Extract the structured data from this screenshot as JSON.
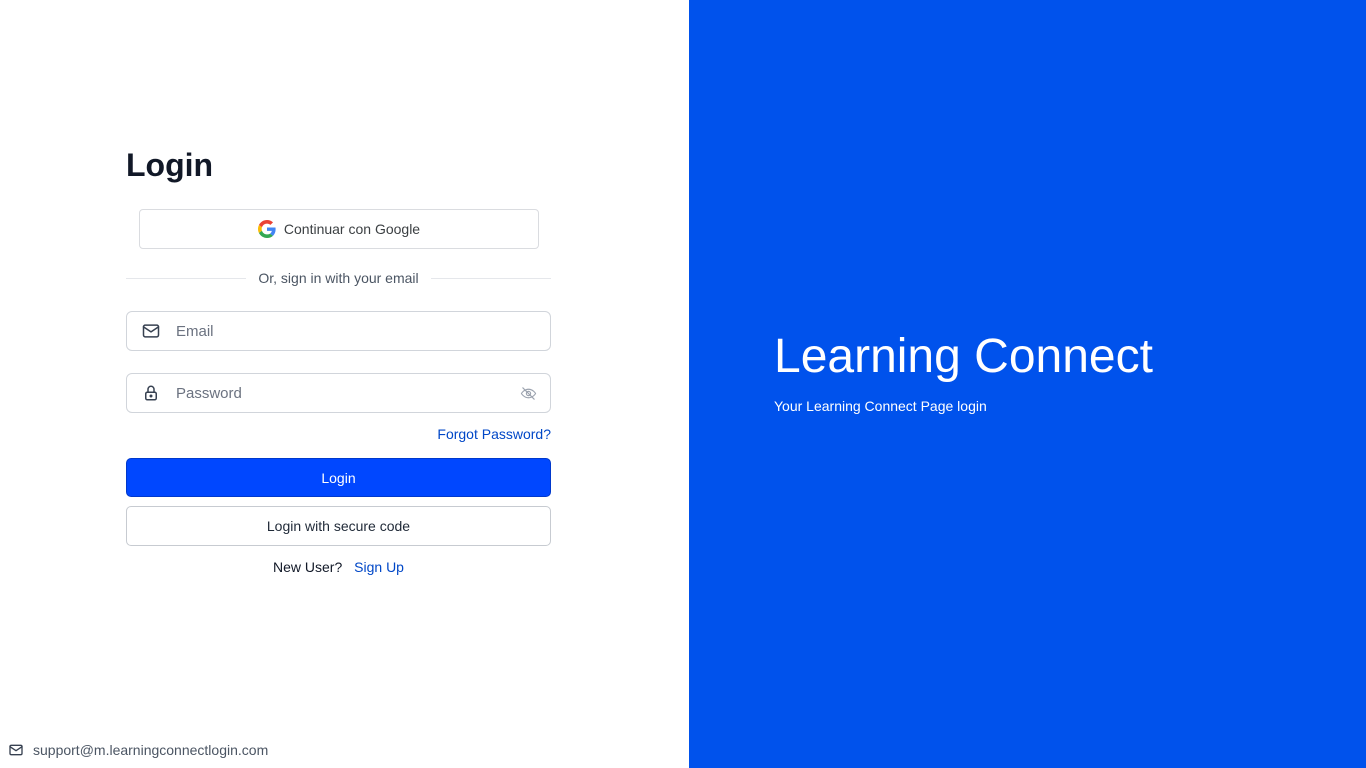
{
  "login": {
    "title": "Login",
    "google_label": "Continuar con Google",
    "divider_text": "Or, sign in with your email",
    "email_placeholder": "Email",
    "password_placeholder": "Password",
    "forgot_label": "Forgot Password?",
    "login_button": "Login",
    "secure_code_button": "Login with secure code",
    "new_user_text": "New User?",
    "signup_label": "Sign Up"
  },
  "footer": {
    "support_email": "support@m.learningconnectlogin.com"
  },
  "brand": {
    "title": "Learning Connect",
    "subtitle": "Your Learning Connect Page login"
  },
  "colors": {
    "brand_panel": "#0052ec",
    "primary_button": "#0047ff",
    "link": "#0047c7"
  },
  "icons": {
    "google": "google-icon",
    "email_field": "mail-icon",
    "password_field": "lock-icon",
    "password_toggle": "eye-off-icon",
    "support": "mail-icon"
  }
}
